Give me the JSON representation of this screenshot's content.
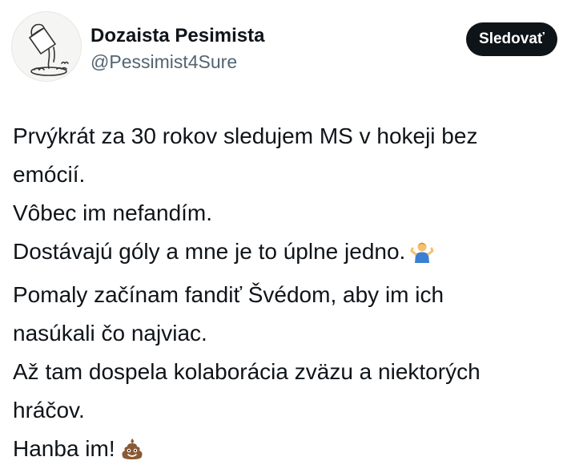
{
  "author": {
    "display_name": "Dozaista Pesimista",
    "handle": "@Pessimist4Sure",
    "avatar_icon": "bucket-pouring-liquid-icon"
  },
  "follow_button": {
    "label": "Sledovať"
  },
  "tweet": {
    "lines": [
      "Prvýkrát za 30 rokov sledujem MS v hokeji bez",
      "emócií.",
      "Vôbec im nefandím.",
      "Dostávajú góly a mne je to úplne jedno.",
      "Pomaly začínam fandiť Švédom, aby im ich",
      "nasúkali čo najviac.",
      "Až tam dospela kolaborácia zväzu a niektorých",
      "hráčov.",
      "Hanba im!"
    ],
    "emojis": [
      "man-shrugging-emoji",
      "pile-of-poo-emoji"
    ]
  },
  "colors": {
    "text": "#0f1419",
    "secondary": "#536471",
    "button_bg": "#0f1419",
    "button_text": "#ffffff"
  }
}
